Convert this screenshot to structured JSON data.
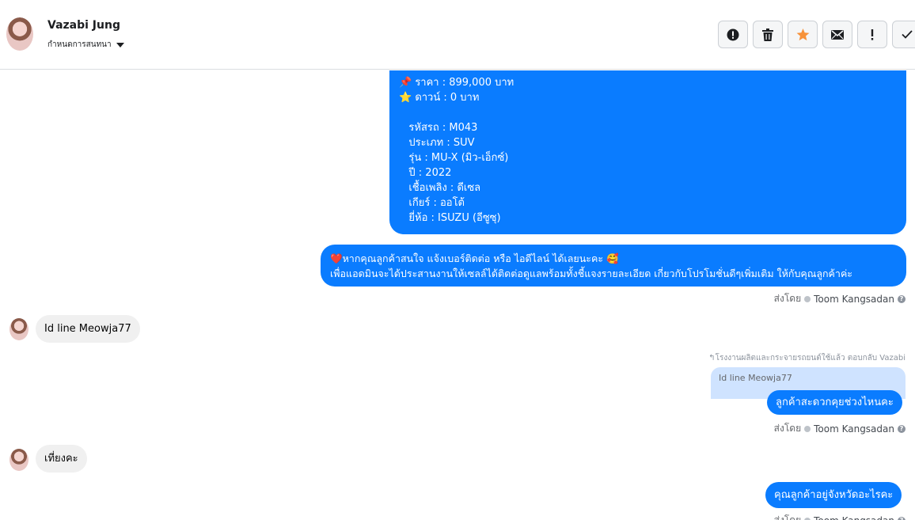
{
  "header": {
    "contact_name": "Vazabi Jung",
    "conversation_menu_label": "กำหนดการสนทนา"
  },
  "messages": {
    "car_details": {
      "lines": [
        "📌 ราคา : 899,000 บาท",
        "⭐ ดาวน์ : 0 บาท",
        "",
        "   รหัสรถ : M043",
        "   ประเภท : SUV",
        "   รุ่น : MU-X (มิว-เอ็กซ์)",
        "   ปี : 2022",
        "   เชื้อเพลิง : ดีเซล",
        "   เกียร์ : ออโต้",
        "   ยี่ห้อ : ISUZU (อีซูซุ)"
      ]
    },
    "contact_prompt": {
      "line1": "❤️หากคุณลูกค้าสนใจ แจ้งเบอร์ติดต่อ หรือ ไอดีไลน์ ได้เลยนะคะ 🥰",
      "line2": "เพื่อแอดมินจะได้ประสานงานให้เซลล์ได้ติดต่อดูแลพร้อมทั้งชี้แจงรายละเอียด เกี่ยวกับโปรโมชั่นดีๆเพิ่มเติม ให้กับคุณลูกค้าค่ะ"
    },
    "sent_by_label": "ส่งโดย",
    "sender_name": "Toom Kangsadan",
    "incoming_1": "Id line Meowja77",
    "reply_note": "โรงงานผลิตและกระจายรถยนต์ใช้แล้ว ตอบกลับ Vazabi",
    "reply_quote": "Id line Meowja77",
    "outgoing_2": "ลูกค้าสะดวกคุยช่วงไหนคะ",
    "incoming_2": "เที่ยงคะ",
    "outgoing_3": "คุณลูกค้าอยู่จังหวัดอะไรคะ"
  }
}
